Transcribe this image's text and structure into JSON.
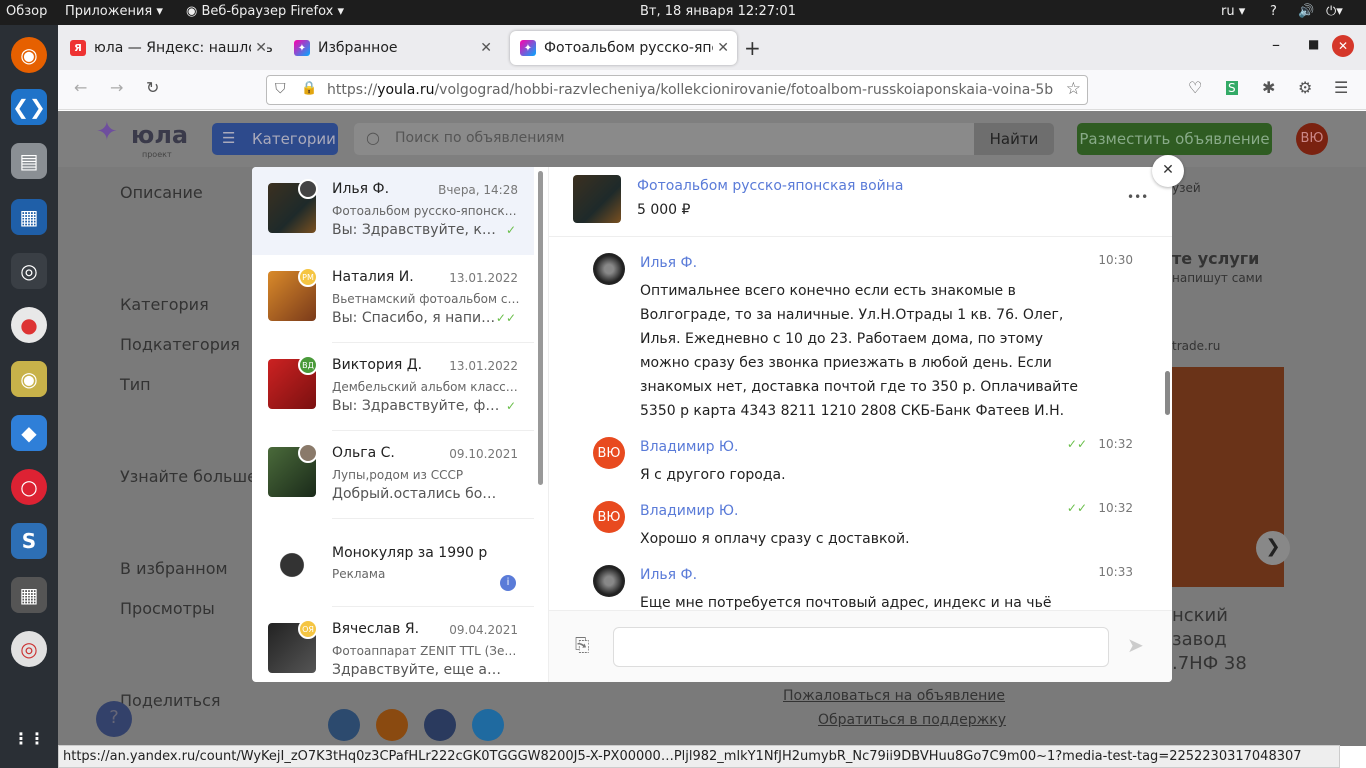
{
  "topbar": {
    "overview": "Обзор",
    "apps": "Приложения",
    "browser_app": "Веб-браузер Firefox",
    "clock": "Вт, 18 января  12:27:01",
    "lang": "ru"
  },
  "tabs": [
    {
      "label": "юла — Яндекс: нашлось"
    },
    {
      "label": "Избранное"
    },
    {
      "label": "Фотоальбом русско-япо"
    }
  ],
  "url": {
    "prefix": "https://",
    "domain": "youla.ru",
    "path": "/volgograd/hobbi-razvlecheniya/kollekcionirovanie/fotoalbom-russkoiaponskaia-voina-5b"
  },
  "site": {
    "logo": "юла",
    "logo_sub": "проект",
    "categories": "Категории",
    "search_placeholder": "Поиск по объявлениям",
    "find": "Найти",
    "post": "Разместить объявление",
    "user_initials": "ВЮ"
  },
  "page_bg": {
    "description": "Описание",
    "category": "Категория",
    "subcategory": "Подкатегория",
    "type": "Тип",
    "learn_more": "Узнайте больше",
    "favorites": "В избранном",
    "views": "Просмотры",
    "share": "Поделиться",
    "report": "Пожаловаться на объявление",
    "support": "Обратиться в поддержку",
    "right_a": "узей",
    "right_b": "те услуги",
    "right_c": "напишут сами",
    "ad_domain": "trade.ru",
    "ad_t1": "нский",
    "ad_t2": "завод",
    "ad_t3": ".7НФ 38"
  },
  "conversations": [
    {
      "name": "Илья Ф.",
      "date": "Вчера, 14:28",
      "subject": "Фотоальбом русско-японская...",
      "last": "Вы: Здравствуйте, когд...",
      "check": "✓"
    },
    {
      "name": "Наталия И.",
      "date": "13.01.2022",
      "subject": "Вьетнамский фотоальбом с л...",
      "last": "Вы: Спасибо, я напишу...",
      "check": "✓✓",
      "badge": "РМ"
    },
    {
      "name": "Виктория Д.",
      "date": "13.01.2022",
      "subject": "Дембельский альбом класси...",
      "last": "Вы: Здравствуйте, фото...",
      "check": "✓",
      "badge": "ВД"
    },
    {
      "name": "Ольга С.",
      "date": "09.10.2021",
      "subject": "Лупы,родом из СССР",
      "last": "Добрый.остались больш..."
    },
    {
      "name": "Монокуляр за 1990 р",
      "subject": "Реклама",
      "info": "i"
    },
    {
      "name": "Вячеслав Я.",
      "date": "09.04.2021",
      "subject": "Фотоаппарат ZENIT TTL (Зени...",
      "last": "Здравствуйте, еще актуал...",
      "badge": "ОЯ"
    }
  ],
  "chat": {
    "title": "Фотоальбом русско-японская война",
    "price": "5 000 ₽",
    "more": "•••",
    "messages": [
      {
        "author": "Илья Ф.",
        "time": "10:30",
        "text": "Оптимальнее всего конечно если есть знакомые в Волгограде, то за наличные. Ул.Н.Отрады 1 кв. 76. Олег, Илья. Ежедневно с 10 до 23. Работаем дома, по этому можно сразу без звонка приезжать в любой день. Если знакомых нет, доставка почтой где то 350 р. Оплачивайте 5350 р карта 4343 8211 1210 2808 СКБ-Банк Фатеев И.Н."
      },
      {
        "author": "Владимир Ю.",
        "time": "10:32",
        "text": "Я с другого города.",
        "initials": "ВЮ",
        "tick": "✓✓"
      },
      {
        "author": "Владимир Ю.",
        "time": "10:32",
        "text": "Хорошо я оплачу сразу с доставкой.",
        "initials": "ВЮ",
        "tick": "✓✓"
      },
      {
        "author": "Илья Ф.",
        "time": "10:33",
        "text": "Еще мне потребуется почтовый адрес, индекс и на чьё имя"
      }
    ]
  },
  "statusbar": "https://an.yandex.ru/count/WyKejI_zO7K3tHq0z3CPafHLr222cGK0TGGGW8200J5-X-PX00000…Pljl982_mlkY1NfJH2umybR_Nc79ii9DBVHuu8Go7C9m00~1?media-test-tag=2252230317048307"
}
